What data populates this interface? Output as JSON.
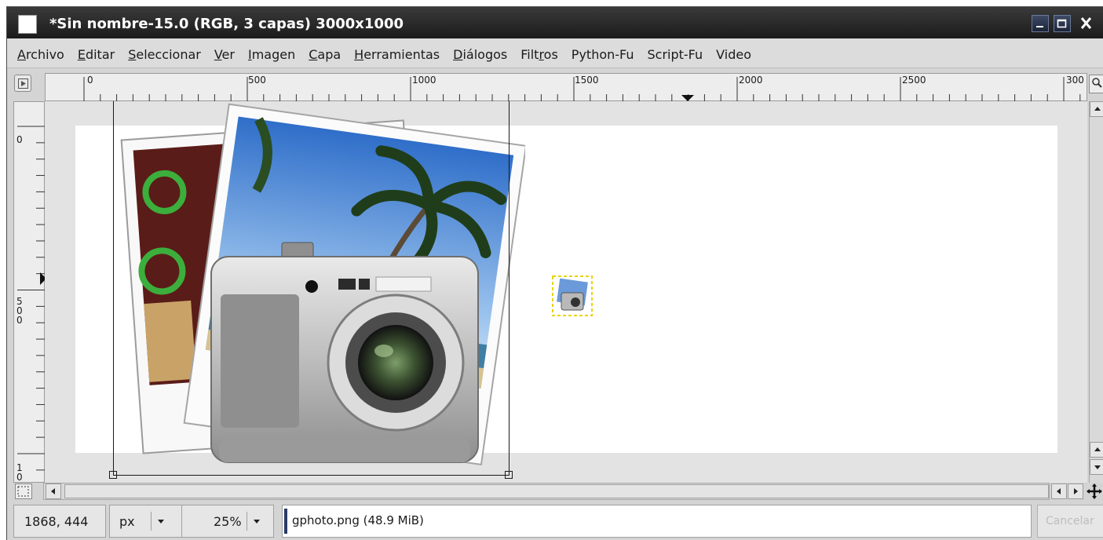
{
  "window": {
    "title": "*Sin nombre-15.0 (RGB, 3 capas) 3000x1000"
  },
  "menubar": {
    "items": [
      {
        "mnemonic": "A",
        "rest": "rchivo"
      },
      {
        "mnemonic": "E",
        "rest": "ditar"
      },
      {
        "mnemonic": "S",
        "rest": "eleccionar"
      },
      {
        "mnemonic": "V",
        "rest": "er"
      },
      {
        "mnemonic": "I",
        "rest": "magen"
      },
      {
        "mnemonic": "C",
        "rest": "apa"
      },
      {
        "mnemonic": "H",
        "rest": "erramientas"
      },
      {
        "mnemonic": "D",
        "rest": "iálogos"
      },
      {
        "pre": "Filt",
        "mnemonic": "r",
        "rest": "os"
      },
      {
        "mnemonic": "",
        "rest": "Python-Fu"
      },
      {
        "mnemonic": "",
        "rest": "Script-Fu"
      },
      {
        "mnemonic": "",
        "rest": "Video"
      }
    ]
  },
  "rulers": {
    "horizontal_labels": [
      "0",
      "500",
      "1000",
      "1500",
      "2000",
      "2500",
      "300"
    ],
    "vertical_labels": [
      "0",
      "5\n0\n0",
      "1\n0"
    ]
  },
  "icons": {
    "menu_nav": "triangle-right-icon",
    "zoom_corner": "magnifier-icon",
    "quick_mask": "quick-mask-icon",
    "navigate": "move-cross-icon"
  },
  "statusbar": {
    "pointer_coords": "1868, 444",
    "unit": "px",
    "zoom": "25%",
    "message": "gphoto.png (48.9 MiB)",
    "cancel_label": "Cancelar"
  },
  "colors": {
    "title_bar": "#1b1b1b",
    "canvas_background": "#e3e3e3",
    "image": "#ffffff",
    "layer_boundary": "#e8d400"
  }
}
